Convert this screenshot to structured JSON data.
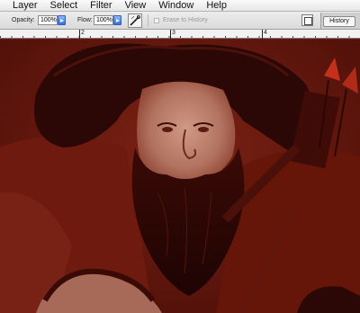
{
  "menubar": {
    "items": [
      "Layer",
      "Select",
      "Filter",
      "View",
      "Window",
      "Help"
    ]
  },
  "options_bar": {
    "opacity_label": "Opacity:",
    "opacity_value": "100%",
    "flow_label": "Flow:",
    "flow_value": "100%",
    "erase_to_history_label": "Erase to History",
    "erase_to_history_checked": false
  },
  "palette_well": {
    "tab_label": "History"
  },
  "ruler": {
    "labels": [
      "2",
      "3",
      "4"
    ]
  },
  "canvas": {
    "content": "painting-of-bearded-man-with-quiver",
    "dominant_color": "#6b1a0f"
  }
}
